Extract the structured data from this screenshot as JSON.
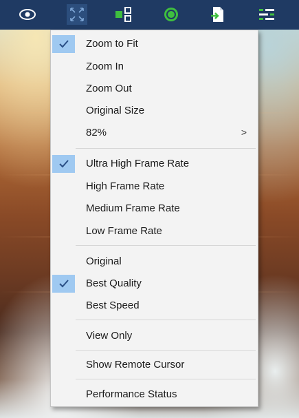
{
  "toolbar": {
    "buttons": [
      {
        "name": "view-icon"
      },
      {
        "name": "fit-screen-icon"
      },
      {
        "name": "switch-screen-icon"
      },
      {
        "name": "record-icon"
      },
      {
        "name": "file-transfer-icon"
      },
      {
        "name": "settings-icon"
      }
    ]
  },
  "menu": {
    "zoom_to_fit": "Zoom to Fit",
    "zoom_in": "Zoom In",
    "zoom_out": "Zoom Out",
    "original_size": "Original Size",
    "zoom_level": "82%",
    "submenu_arrow": ">",
    "ultra_high_frame_rate": "Ultra High Frame Rate",
    "high_frame_rate": "High Frame Rate",
    "medium_frame_rate": "Medium Frame Rate",
    "low_frame_rate": "Low Frame Rate",
    "original": "Original",
    "best_quality": "Best Quality",
    "best_speed": "Best Speed",
    "view_only": "View Only",
    "show_remote_cursor": "Show Remote Cursor",
    "performance_status": "Performance Status",
    "checked_items": [
      "Zoom to Fit",
      "Ultra High Frame Rate",
      "Best Quality"
    ]
  },
  "colors": {
    "toolbar_bg": "#1f3a63",
    "checked_bg": "#9fc9f1",
    "menu_bg": "#f3f3f3",
    "icon_green": "#3fbf3f"
  }
}
